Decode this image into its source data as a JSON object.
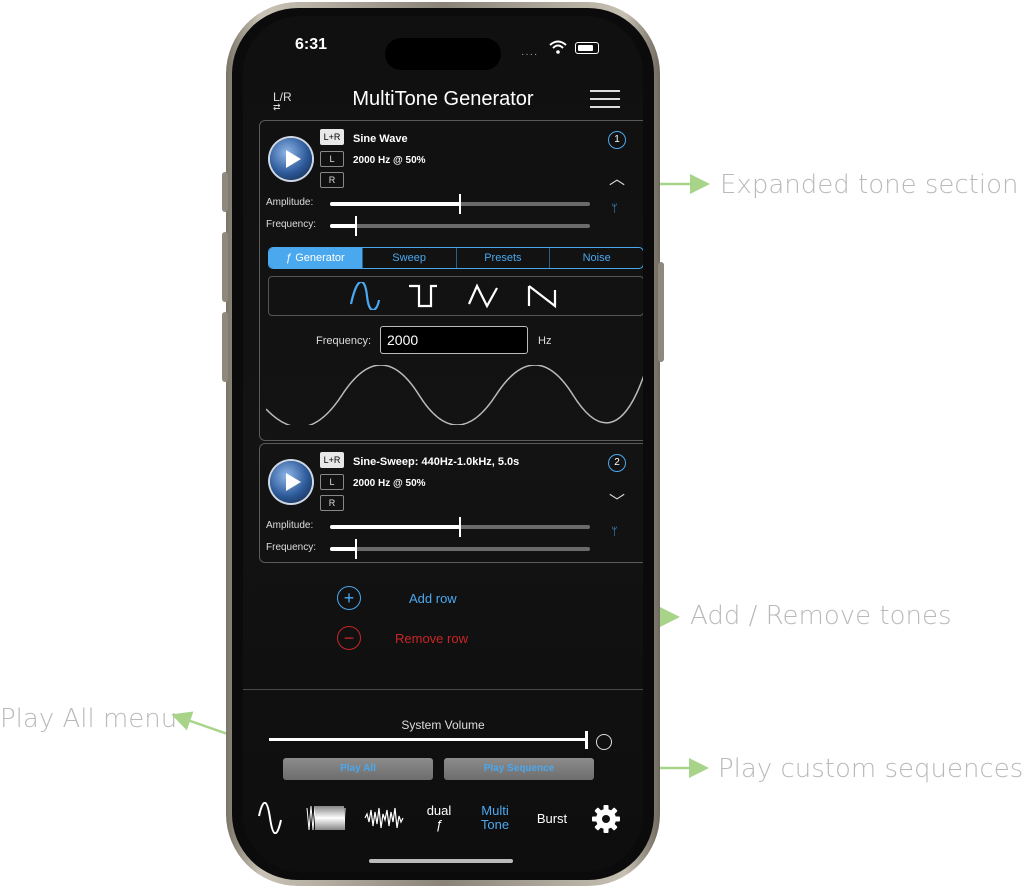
{
  "annotations": {
    "expanded": "Expanded tone section",
    "add_remove": "Add / Remove tones",
    "play_all": "Play All menu",
    "custom": "Play custom sequences"
  },
  "status_bar": {
    "time": "6:31"
  },
  "header": {
    "title": "MultiTone Generator",
    "lr_label": "L/R"
  },
  "channels": {
    "both": "L+R",
    "left": "L",
    "right": "R"
  },
  "tones": [
    {
      "number": "1",
      "name": "Sine Wave",
      "detail": "2000 Hz @ 50%",
      "amplitude_label": "Amplitude:",
      "frequency_label": "Frequency:",
      "amplitude_level": 0.5,
      "frequency_level": 0.1
    },
    {
      "number": "2",
      "name": "Sine-Sweep: 440Hz-1.0kHz, 5.0s",
      "detail": "2000 Hz @ 50%",
      "amplitude_label": "Amplitude:",
      "frequency_label": "Frequency:",
      "amplitude_level": 0.5,
      "frequency_level": 0.1
    }
  ],
  "tabs": [
    "ƒ Generator",
    "Sweep",
    "Presets",
    "Noise"
  ],
  "waveforms": [
    "sine-icon",
    "square-icon",
    "triangle-icon",
    "sawtooth-icon"
  ],
  "generator": {
    "frequency_label": "Frequency:",
    "frequency_value": "2000",
    "unit": "Hz"
  },
  "actions": {
    "add": "Add row",
    "remove": "Remove row"
  },
  "volume": {
    "label": "System Volume",
    "level": 1.0
  },
  "buttons": {
    "play_all": "Play All",
    "play_sequence": "Play Sequence"
  },
  "tabbar": {
    "dual": "dual",
    "dual_f": "ƒ",
    "multi1": "Multi",
    "multi2": "Tone",
    "burst": "Burst",
    "active": "Multi Tone"
  },
  "colors": {
    "accent": "#4aa8ef",
    "remove": "#c82626",
    "annotation": "#b9b9b9",
    "arrow": "#a8d48a"
  }
}
